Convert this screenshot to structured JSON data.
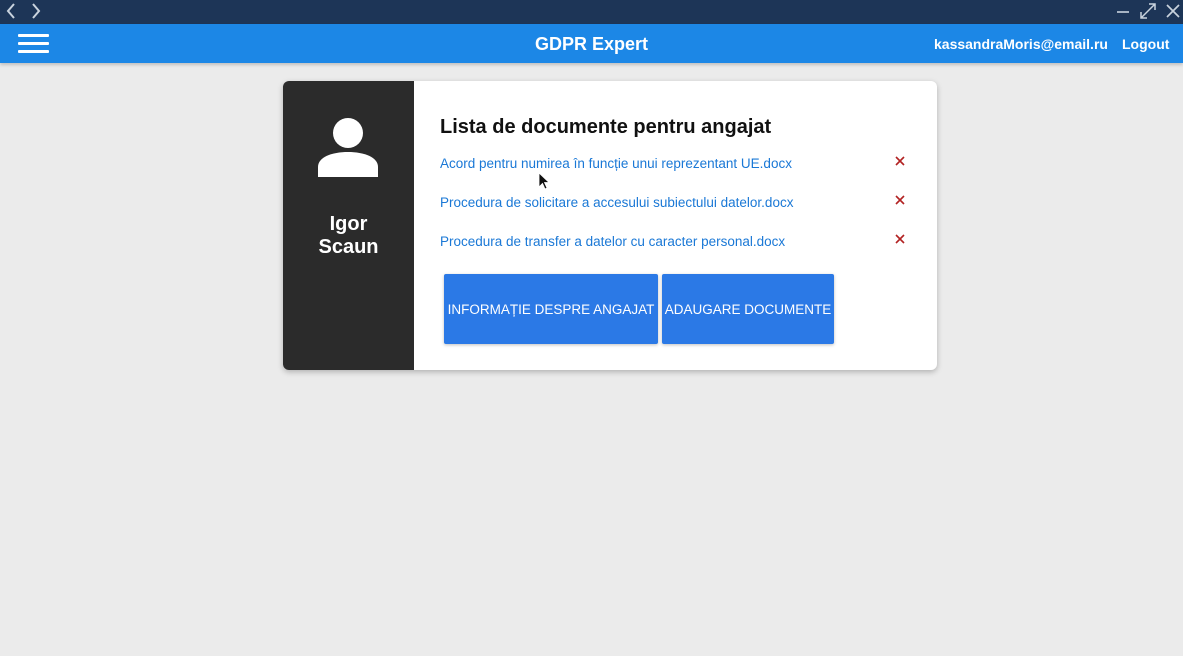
{
  "app": {
    "title": "GDPR Expert",
    "user_email": "kassandraMoris@email.ru",
    "logout_label": "Logout"
  },
  "employee": {
    "first_name": "Igor",
    "last_name": "Scaun"
  },
  "documents": {
    "title": "Lista de documente pentru angajat",
    "items": [
      {
        "name": "Acord pentru numirea în funcție unui reprezentant UE.docx",
        "remove_icon": "close-icon"
      },
      {
        "name": "Procedura de solicitare a accesului subiectului datelor.docx",
        "remove_icon": "close-icon"
      },
      {
        "name": "Procedura de transfer a datelor cu caracter personal.docx",
        "remove_icon": "close-icon"
      }
    ]
  },
  "actions": {
    "info_label": "INFORMAȚIE DESPRE ANGAJAT",
    "add_docs_label": "ADAUGARE DOCUMENTE"
  },
  "colors": {
    "appbar": "#1c87e6",
    "chrome": "#1d3557",
    "sidebar": "#2b2b2b",
    "link": "#1a78d6",
    "button": "#2b79e6",
    "remove": "#b22222"
  },
  "icons": [
    "back-icon",
    "forward-icon",
    "minimize-icon",
    "maximize-icon",
    "window-close-icon",
    "hamburger-menu-icon",
    "user-avatar-icon",
    "close-icon",
    "mouse-cursor-icon"
  ]
}
